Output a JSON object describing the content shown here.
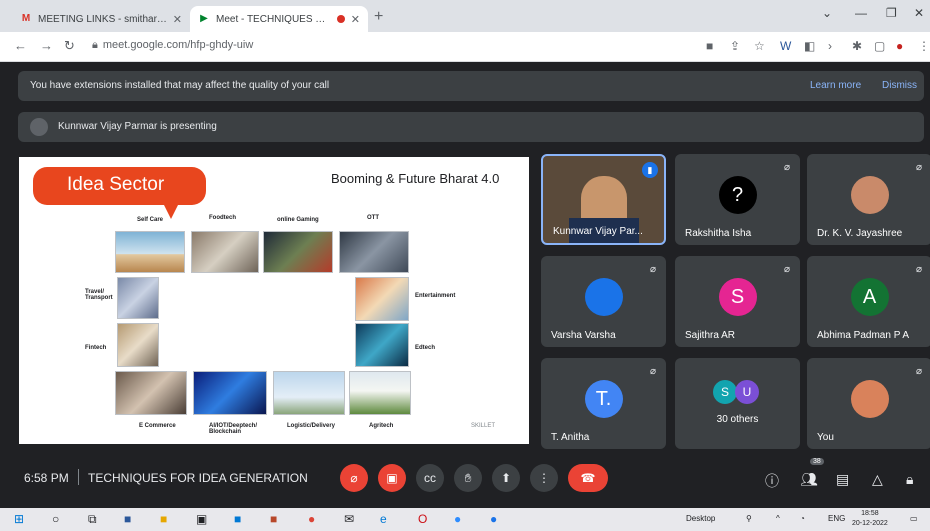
{
  "browser": {
    "tabs": [
      {
        "label": "MEETING LINKS - smitharmair@",
        "icon": "gmail-icon"
      },
      {
        "label": "Meet - TECHNIQUES FOR ID",
        "icon": "meet-icon"
      }
    ],
    "url": "meet.google.com/hfp-ghdy-uiw"
  },
  "notice": {
    "message": "You have extensions installed that may affect the quality of your call",
    "learn_more": "Learn more",
    "dismiss": "Dismiss"
  },
  "presenting": {
    "text": "Kunnwar Vijay Parmar is presenting"
  },
  "slide": {
    "badge": "Idea Sector",
    "title": "Booming & Future Bharat 4.0",
    "labels": {
      "self_care": "Self Care",
      "foodtech": "Foodtech",
      "online_gaming": "online Gaming",
      "ott": "OTT",
      "travel": "Travel/ Transport",
      "fintech": "Fintech",
      "entertainment": "Entertainment",
      "edtech": "Edtech",
      "ecommerce": "E Commerce",
      "ai": "AI/IOT/Deeptech/ Blockchain",
      "logistic": "Logistic/Delivery",
      "agritech": "Agritech"
    },
    "watermark": "SKILLET"
  },
  "participants": [
    {
      "name": "Kunnwar Vijay Par...",
      "speaking": true
    },
    {
      "name": "Rakshitha Isha",
      "avatar_letter": "?",
      "avatar_color": "#000000"
    },
    {
      "name": "Dr. K. V. Jayashree",
      "avatar_color": "#c98a6a"
    },
    {
      "name": "Varsha Varsha",
      "avatar_color": "#1a73e8"
    },
    {
      "name": "Sajithra AR",
      "avatar_letter": "S",
      "avatar_color": "#e52592"
    },
    {
      "name": "Abhima Padman P A",
      "avatar_letter": "A",
      "avatar_color": "#137333"
    },
    {
      "name": "T. Anitha",
      "avatar_letter": "T.",
      "avatar_color": "#4285f4"
    },
    {
      "name": "30 others",
      "avatar_letters": [
        "S",
        "U"
      ]
    },
    {
      "name": "You",
      "avatar_color": "#d9825b"
    }
  ],
  "bottom_bar": {
    "time": "6:58 PM",
    "meeting_name": "TECHNIQUES FOR IDEA GENERATION",
    "participant_count": "38"
  },
  "taskbar": {
    "desktop_label": "Desktop",
    "language": "ENG",
    "clock_time": "18:58",
    "clock_date": "20-12-2022"
  }
}
